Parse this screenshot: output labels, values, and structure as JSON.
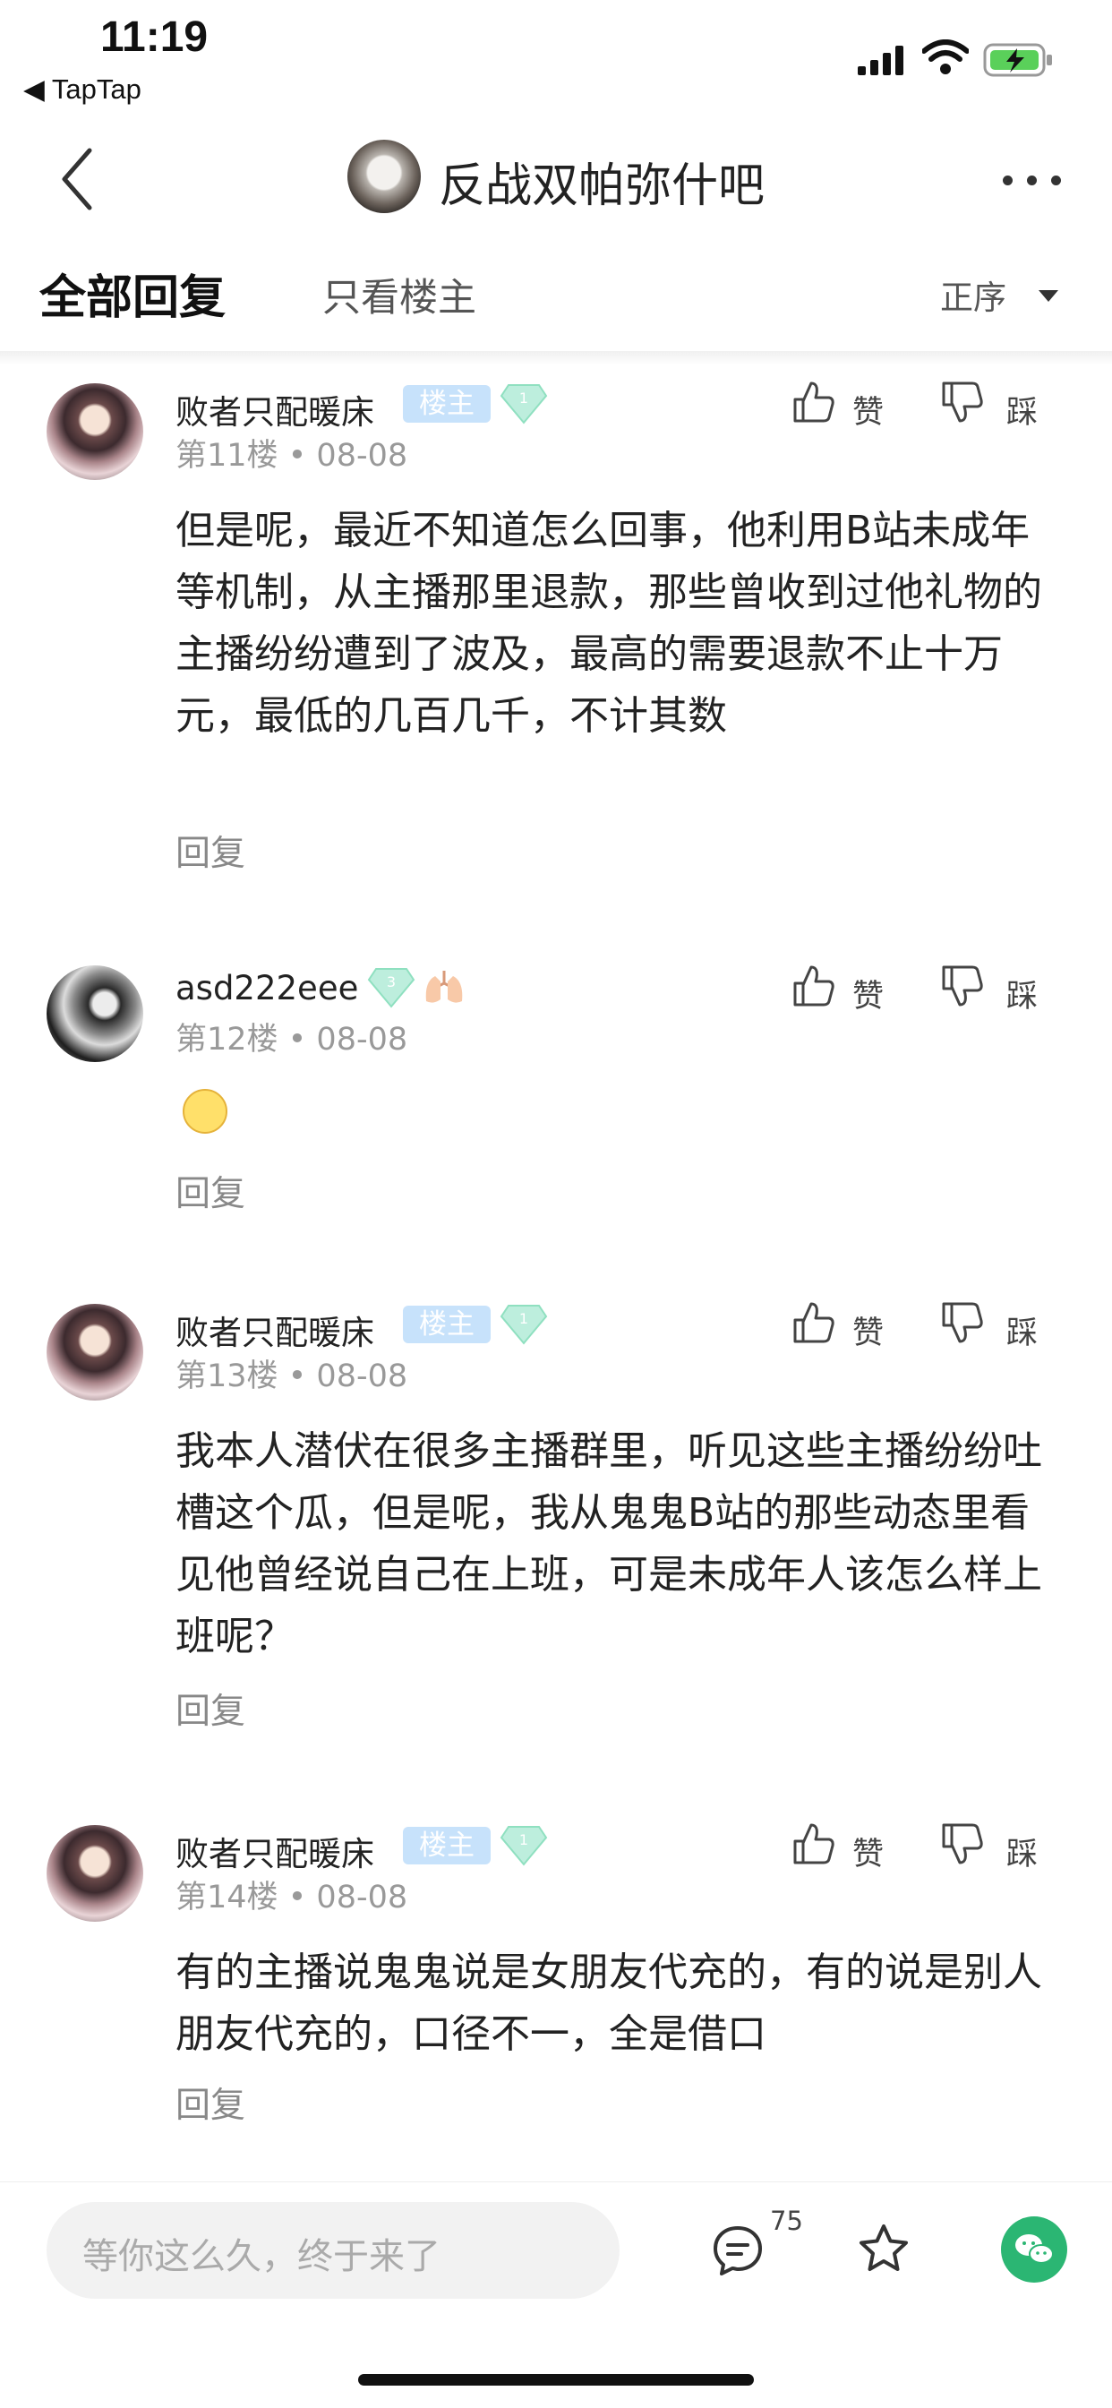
{
  "status_bar": {
    "time": "11:19",
    "back_app": "◀ TapTap"
  },
  "nav": {
    "title": "反战双帕弥什吧",
    "back_icon": "chevron-left-icon",
    "more_icon": "more-dots-icon"
  },
  "tabs": {
    "all_replies": "全部回复",
    "only_op": "只看楼主",
    "sort": "正序"
  },
  "posts": [
    {
      "username": "败者只配暖床",
      "host_badge": "楼主",
      "level": "1",
      "floor": "第11楼 • 08-08",
      "like_label": "赞",
      "dislike_label": "踩",
      "content": "但是呢，最近不知道怎么回事，他利用B站未成年等机制，从主播那里退款，那些曾收到过他礼物的主播纷纷遭到了波及，最高的需要退款不止十万元，最低的几百几千，不计其数",
      "reply": "回复"
    },
    {
      "username": "asd222eee",
      "level": "3",
      "floor": "第12楼 • 08-08",
      "like_label": "赞",
      "dislike_label": "踩",
      "reply": "回复"
    },
    {
      "username": "败者只配暖床",
      "host_badge": "楼主",
      "level": "1",
      "floor": "第13楼 • 08-08",
      "like_label": "赞",
      "dislike_label": "踩",
      "content": "我本人潜伏在很多主播群里，听见这些主播纷纷吐槽这个瓜，但是呢，我从鬼鬼B站的那些动态里看见他曾经说自己在上班，可是未成年人该怎么样上班呢？",
      "reply": "回复"
    },
    {
      "username": "败者只配暖床",
      "host_badge": "楼主",
      "level": "1",
      "floor": "第14楼 • 08-08",
      "like_label": "赞",
      "dislike_label": "踩",
      "content": "有的主播说鬼鬼说是女朋友代充的，有的说是别人朋友代充的，口径不一，全是借口",
      "reply": "回复"
    }
  ],
  "bottom_bar": {
    "input_placeholder": "等你这么久，终于来了",
    "comment_count": "75",
    "colors": {
      "wechat": "#2bb673",
      "host_badge": "#c7e2fb",
      "level_gem": "#8fe0c0"
    }
  }
}
